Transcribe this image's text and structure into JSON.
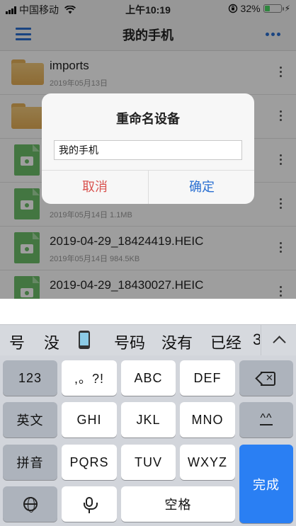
{
  "status_bar": {
    "carrier": "中国移动",
    "time": "上午10:19",
    "battery": "32%",
    "battery_level": 0.32
  },
  "header": {
    "title": "我的手机"
  },
  "files": [
    {
      "type": "folder",
      "name": "imports",
      "meta": "2019年05月13日"
    },
    {
      "type": "folder",
      "name": "",
      "meta": ""
    },
    {
      "type": "image",
      "name": "",
      "meta": ""
    },
    {
      "type": "image",
      "name": "",
      "meta": "2019年05月14日  1.1MB"
    },
    {
      "type": "image",
      "name": "2019-04-29_18424419.HEIC",
      "meta": "2019年05月14日  984.5KB"
    },
    {
      "type": "image",
      "name": "2019-04-29_18430027.HEIC",
      "meta": ""
    }
  ],
  "dialog": {
    "title": "重命名设备",
    "input_value": "我的手机",
    "cancel_label": "取消",
    "ok_label": "确定"
  },
  "candidates": [
    "号",
    "没",
    "号码",
    "没有",
    "已经",
    "3"
  ],
  "keyboard": {
    "row1": [
      "123",
      ",。?!",
      "ABC",
      "DEF"
    ],
    "row2": [
      "英文",
      "GHI",
      "JKL",
      "MNO"
    ],
    "row3": [
      "拼音",
      "PQRS",
      "TUV",
      "WXYZ"
    ],
    "space": "空格",
    "done": "完成"
  },
  "colors": {
    "accent": "#2a6fd1",
    "cancel": "#d9534f",
    "done_key": "#2a7ff3"
  }
}
